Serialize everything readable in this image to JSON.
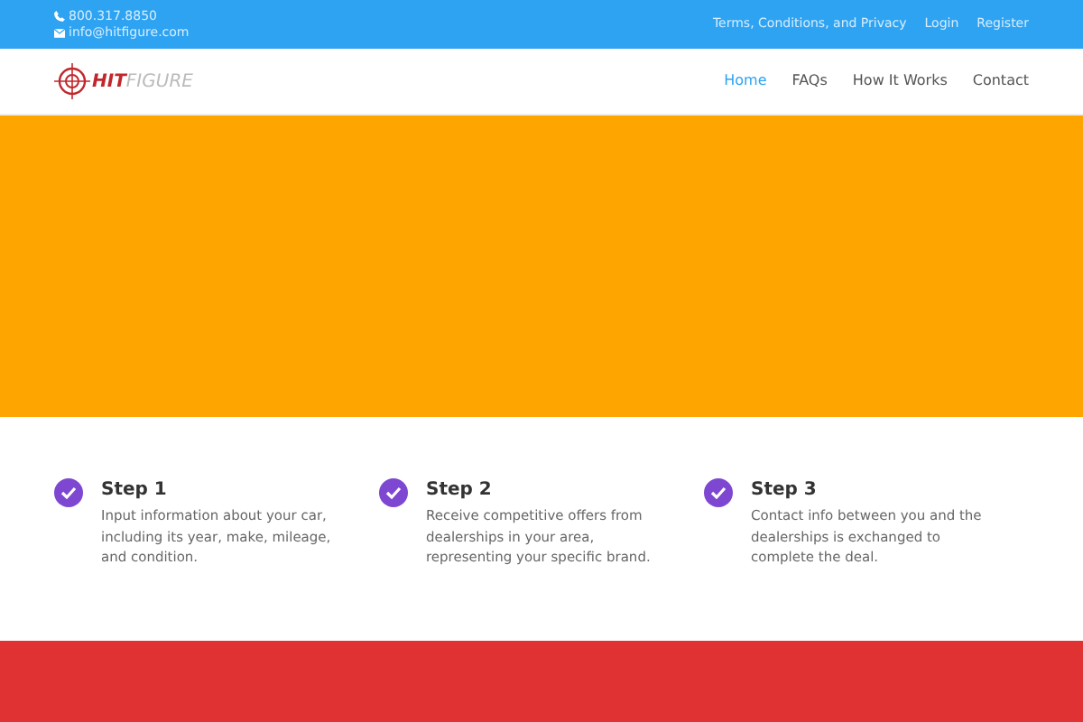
{
  "top_bar": {
    "phone": "800.317.8850",
    "email": "info@hitfigure.com",
    "links": [
      "Terms, Conditions, and Privacy",
      "Login",
      "Register"
    ]
  },
  "header": {
    "logo": {
      "part_1": "HIT",
      "part_2": "FIGURE"
    },
    "nav": [
      {
        "label": "Home",
        "selected": true
      },
      {
        "label": "FAQs",
        "selected": false
      },
      {
        "label": "How It Works",
        "selected": false
      },
      {
        "label": "Contact",
        "selected": false
      }
    ]
  },
  "steps": [
    {
      "title": "Step 1",
      "text": "Input information about your car, including its year, make, mileage, and condition."
    },
    {
      "title": "Step 2",
      "text": "Receive competitive offers from dealerships in your area, representing your specific brand."
    },
    {
      "title": "Step 3",
      "text": "Contact info between you and the dealerships is exchanged to complete the deal."
    }
  ]
}
